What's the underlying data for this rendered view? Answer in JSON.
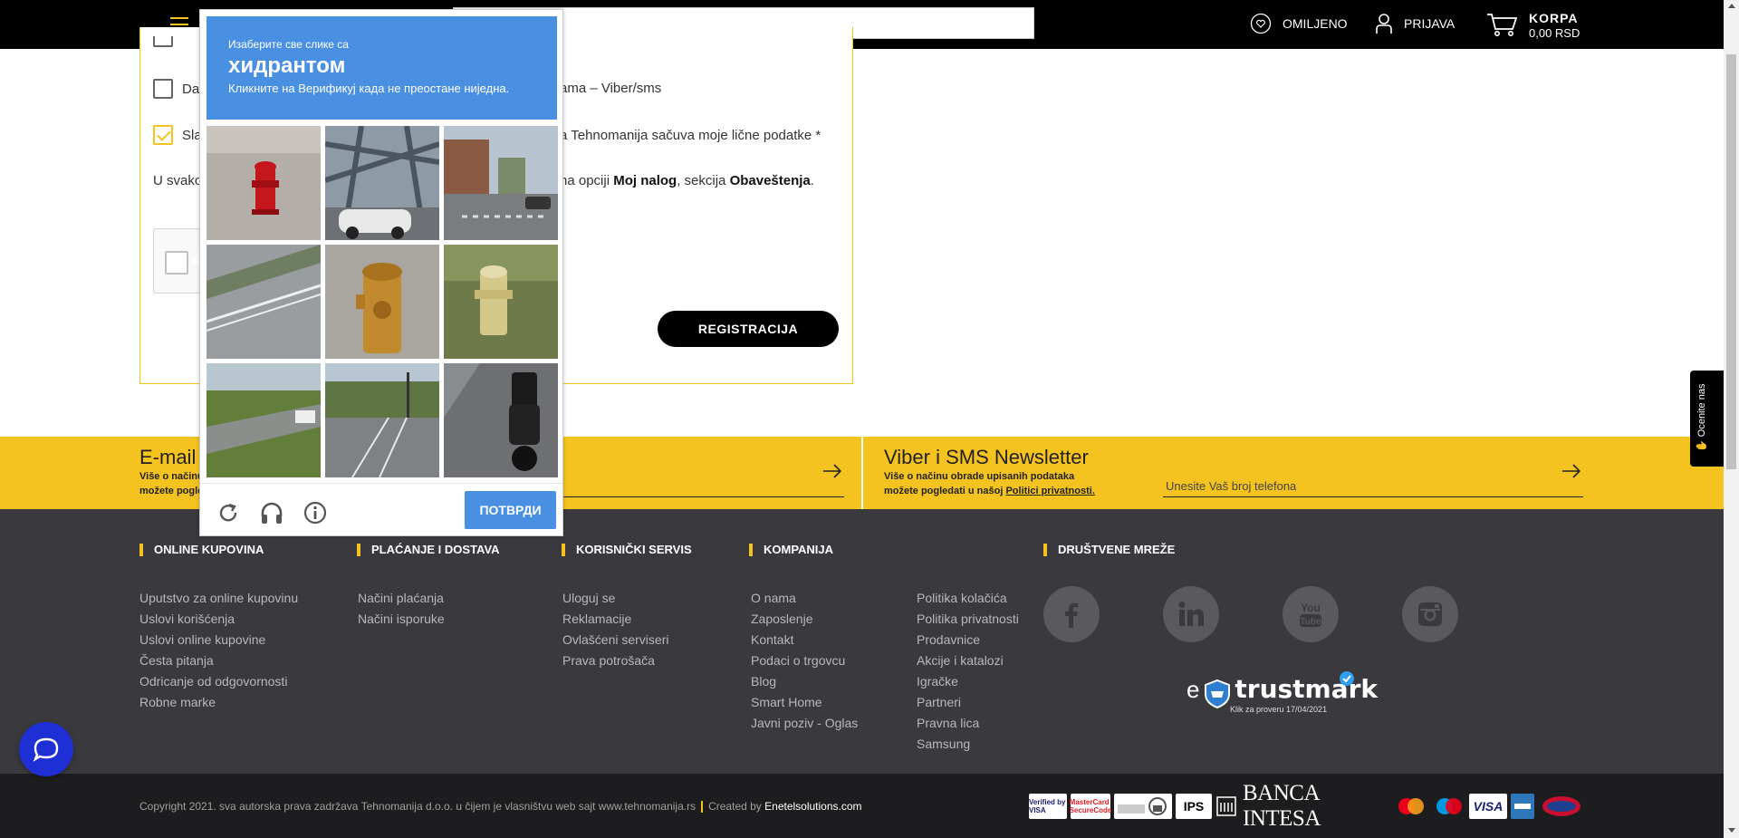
{
  "header": {
    "favorites_label": "OMILJENO",
    "login_label": "PRIJAVA",
    "cart_label": "KORPA",
    "cart_total": "0,00 RSD",
    "search_value": ""
  },
  "form": {
    "checkbox_viber_label": "Da,",
    "checkbox_viber_tail": "ama – Viber/sms",
    "checkbox_consent_label": "Sla",
    "checkbox_consent_tail": "a Tehnomanija sačuva moje lične podatke *",
    "info_start": "U svako",
    "info_mid": "na opciji ",
    "info_link1": "Moj nalog",
    "info_sep": ", sekcija ",
    "info_link2": "Obaveštenja",
    "info_end": ".",
    "register_button": "REGISTRACIJA"
  },
  "captcha": {
    "prompt_line1": "Изаберите све слике са",
    "prompt_object": "хидрантом",
    "prompt_line3": "Кликните на Верификуј када не преостане ниједна.",
    "verify_button": "ПОТВРДИ",
    "tiles": [
      "red-hydrant",
      "bridge-car",
      "street-building",
      "road",
      "yellow-hydrant-closeup",
      "yellow-hydrant-grass",
      "grass-truck",
      "road-intersection",
      "motorcycle"
    ]
  },
  "newsletter": {
    "email_title": "E-mail",
    "email_desc1": "Više o načinu",
    "email_desc2": "možete pogle",
    "viber_title": "Viber i SMS Newsletter",
    "viber_desc1": "Više o načinu obrade upisanih podataka",
    "viber_desc2": "možete pogledati u našoj ",
    "viber_link": "Politici privatnosti.",
    "viber_placeholder": "Unesite Vaš broj telefona"
  },
  "footer": {
    "columns": [
      {
        "title": "ONLINE KUPOVINA",
        "items": [
          "Uputstvo za online kupovinu",
          "Uslovi korišćenja",
          "Uslovi online kupovine",
          "Česta pitanja",
          "Odricanje od odgovornosti",
          "Robne marke"
        ]
      },
      {
        "title": "PLAĆANJE I DOSTAVA",
        "items": [
          "Načini plaćanja",
          "Načini isporuke"
        ]
      },
      {
        "title": "KORISNIČKI SERVIS",
        "items": [
          "Uloguj se",
          "Reklamacije",
          "Ovlašćeni serviseri",
          "Prava potrošača"
        ]
      },
      {
        "title": "KOMPANIJA",
        "items": [
          "O nama",
          "Zaposlenje",
          "Kontakt",
          "Podaci o trgovcu",
          "Blog",
          "Smart Home",
          "Javni poziv - Oglas"
        ]
      },
      {
        "title": "",
        "items": [
          "Politika kolačića",
          "Politika privatnosti",
          "Prodavnice",
          "Akcije i katalozi",
          "Igračke",
          "Partneri",
          "Pravna lica",
          "Samsung"
        ]
      }
    ],
    "social_title": "DRUŠTVENE MREŽE",
    "trustmark": "trustmark",
    "trustmark_sub": "Klik za proveru 17/04/2021",
    "copyright": "Copyright 2021. sva autorska prava zadržava Tehnomanija d.o.o. u čijem je vlasništvu web sajt www.tehnomanija.rs",
    "created_by": "Created by ",
    "created_by_link": "Enetelsolutions.com",
    "payment_banca": "BANCA INTESA",
    "payment_visa_text": "Verified by VISA",
    "payment_mc_text": "MasterCard SecureCode",
    "payment_ips": "IPS",
    "payment_visa": "VISA"
  },
  "side_tab_label": "Ocenite nas",
  "colors": {
    "accent_yellow": "#f4c320",
    "captcha_blue": "#4a90e2",
    "footer_bg": "#3a3a3e",
    "chat_blue": "#1f2fd6"
  }
}
